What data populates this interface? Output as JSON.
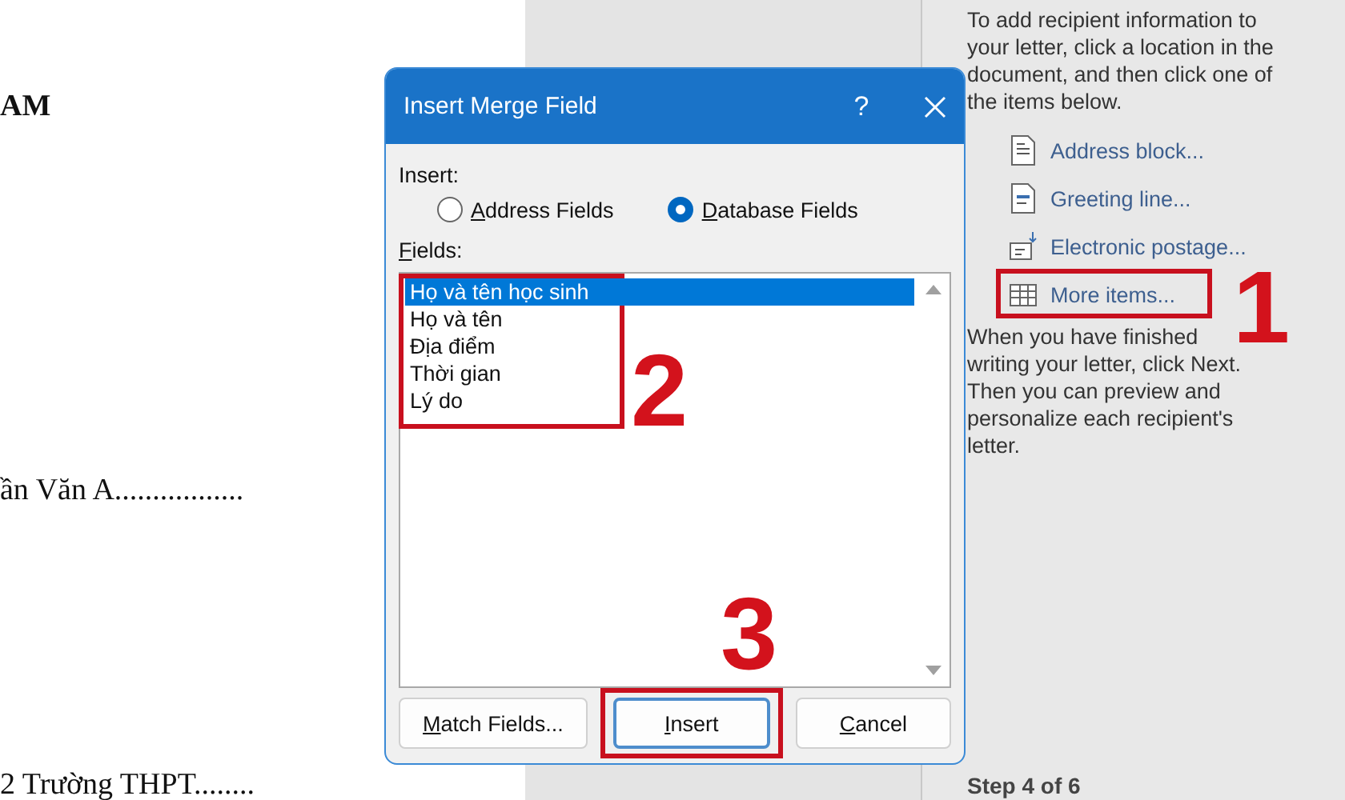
{
  "document": {
    "lines": [
      {
        "text": "AM",
        "kind": "heading"
      },
      {
        "text": "ần Văn A.................",
        "kind": "body"
      },
      {
        "text": "2 Trường THPT........",
        "kind": "body"
      }
    ]
  },
  "dialog": {
    "title": "Insert Merge Field",
    "help": "?",
    "insert_label": "Insert:",
    "radios": [
      {
        "label": "Address Fields",
        "selected": false
      },
      {
        "label": "Database Fields",
        "selected": true
      }
    ],
    "fields_label": "Fields:",
    "fields": [
      {
        "label": "Họ và tên học sinh",
        "selected": true
      },
      {
        "label": "Họ và tên",
        "selected": false
      },
      {
        "label": "Địa điểm",
        "selected": false
      },
      {
        "label": "Thời gian",
        "selected": false
      },
      {
        "label": "Lý do",
        "selected": false
      }
    ],
    "buttons": [
      {
        "label": "Match Fields...",
        "default": false
      },
      {
        "label": "Insert",
        "default": true
      },
      {
        "label": "Cancel",
        "default": false
      }
    ]
  },
  "task_pane": {
    "intro": "To add recipient information to your letter, click a location in the document, and then click one of the items below.",
    "items": [
      {
        "label": "Address block...",
        "kind": "address"
      },
      {
        "label": "Greeting line...",
        "kind": "greeting"
      },
      {
        "label": "Electronic postage...",
        "kind": "postage"
      },
      {
        "label": "More items...",
        "kind": "more"
      }
    ],
    "outro": "When you have finished writing your letter, click Next. Then you can preview and personalize each recipient's letter.",
    "step": "Step 4 of 6"
  },
  "annotations": [
    {
      "number": "1"
    },
    {
      "number": "2"
    },
    {
      "number": "3"
    }
  ]
}
